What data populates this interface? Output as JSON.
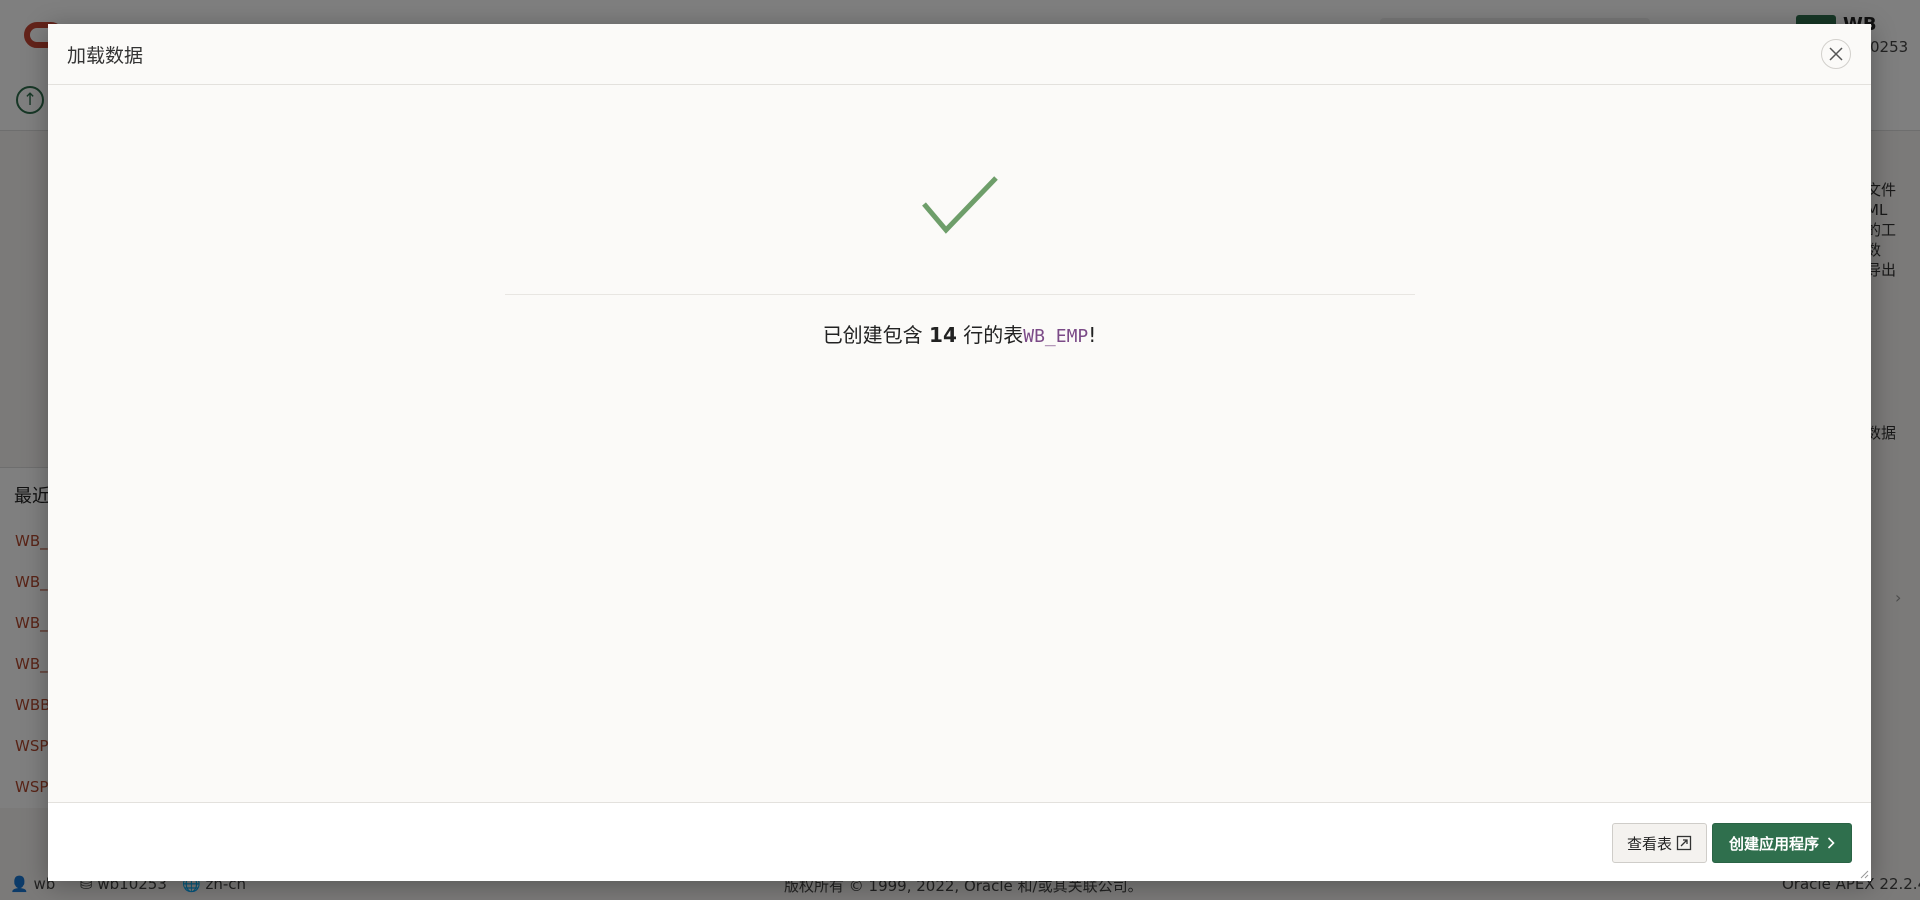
{
  "background": {
    "user_initials": "",
    "user_name": "WB",
    "workspace_id": "0253",
    "right_panel_lines": [
      "文件",
      "ML",
      "的工",
      "数",
      "导出"
    ],
    "right_panel_load": "数据",
    "recent_title": "最近",
    "recent_items": [
      "WB_",
      "WB_",
      "WB_",
      "WB_",
      "WBB",
      "WSP",
      "WSP"
    ],
    "footer": {
      "user": "wb",
      "workspace": "wb10253",
      "language": "zh-cn",
      "copyright": "版权所有 © 1999, 2022, Oracle 和/或其关联公司。",
      "version": "Oracle APEX 22.2.4"
    }
  },
  "dialog": {
    "title": "加载数据",
    "close_label": "×",
    "message": {
      "prefix": "已创建包含",
      "row_count": "14",
      "middle": "行的表",
      "table_name": "WB_EMP",
      "suffix": "!"
    },
    "buttons": {
      "view_table": "查看表",
      "create_app": "创建应用程序"
    }
  },
  "colors": {
    "accent_green": "#2f6f4d",
    "check_green": "#6e9e6a",
    "table_name_purple": "#7b4a87"
  }
}
